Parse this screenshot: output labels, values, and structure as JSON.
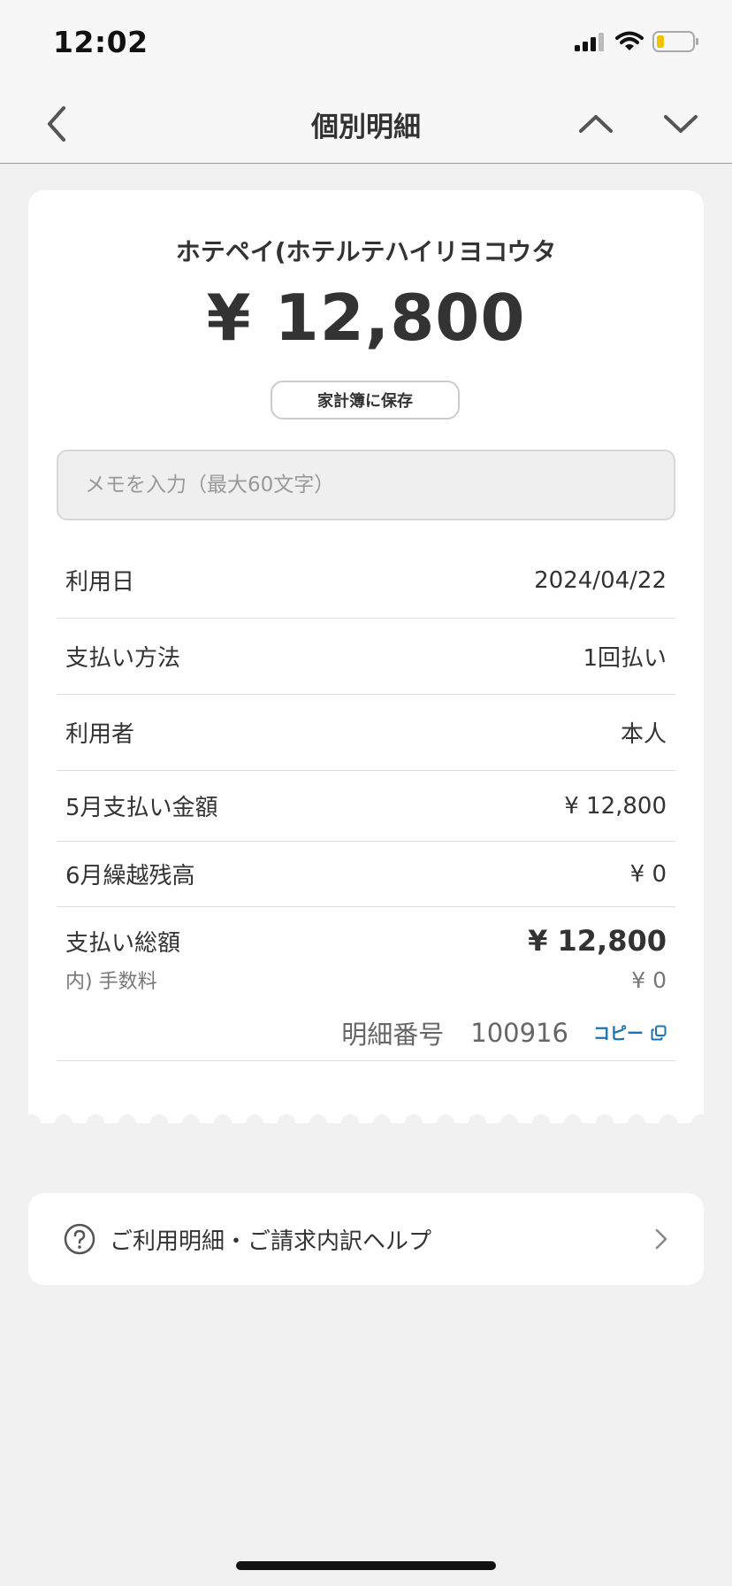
{
  "status_bar": {
    "time": "12:02"
  },
  "nav": {
    "title": "個別明細",
    "back_icon": "chevron-left-icon",
    "prev_icon": "chevron-up-icon",
    "next_icon": "chevron-down-icon"
  },
  "receipt": {
    "merchant": "ホテペイ(ホテルテハイリヨコウタ",
    "amount": "¥ 12,800",
    "save_button_label": "家計簿に保存",
    "memo_placeholder": "メモを入力（最大60文字）",
    "rows": [
      {
        "label": "利用日",
        "value": "2024/04/22"
      },
      {
        "label": "支払い方法",
        "value": "1回払い"
      },
      {
        "label": "利用者",
        "value": "本人"
      },
      {
        "label": "5月支払い金額",
        "value": "¥ 12,800"
      },
      {
        "label": "6月繰越残高",
        "value": "¥ 0"
      }
    ],
    "total": {
      "label": "支払い総額",
      "value": "¥ 12,800"
    },
    "fee": {
      "label": "内) 手数料",
      "value": "¥ 0"
    },
    "detail_number": {
      "label": "明細番号",
      "value": "100916",
      "copy_label": "コピー"
    }
  },
  "help": {
    "label": "ご利用明細・ご請求内訳ヘルプ",
    "icon": "help-circle-icon",
    "chevron_icon": "chevron-right-icon"
  },
  "colors": {
    "background": "#f1f1f1",
    "card": "#ffffff",
    "text": "#333333",
    "link": "#1a73b4",
    "battery_low": "#f2c200"
  }
}
